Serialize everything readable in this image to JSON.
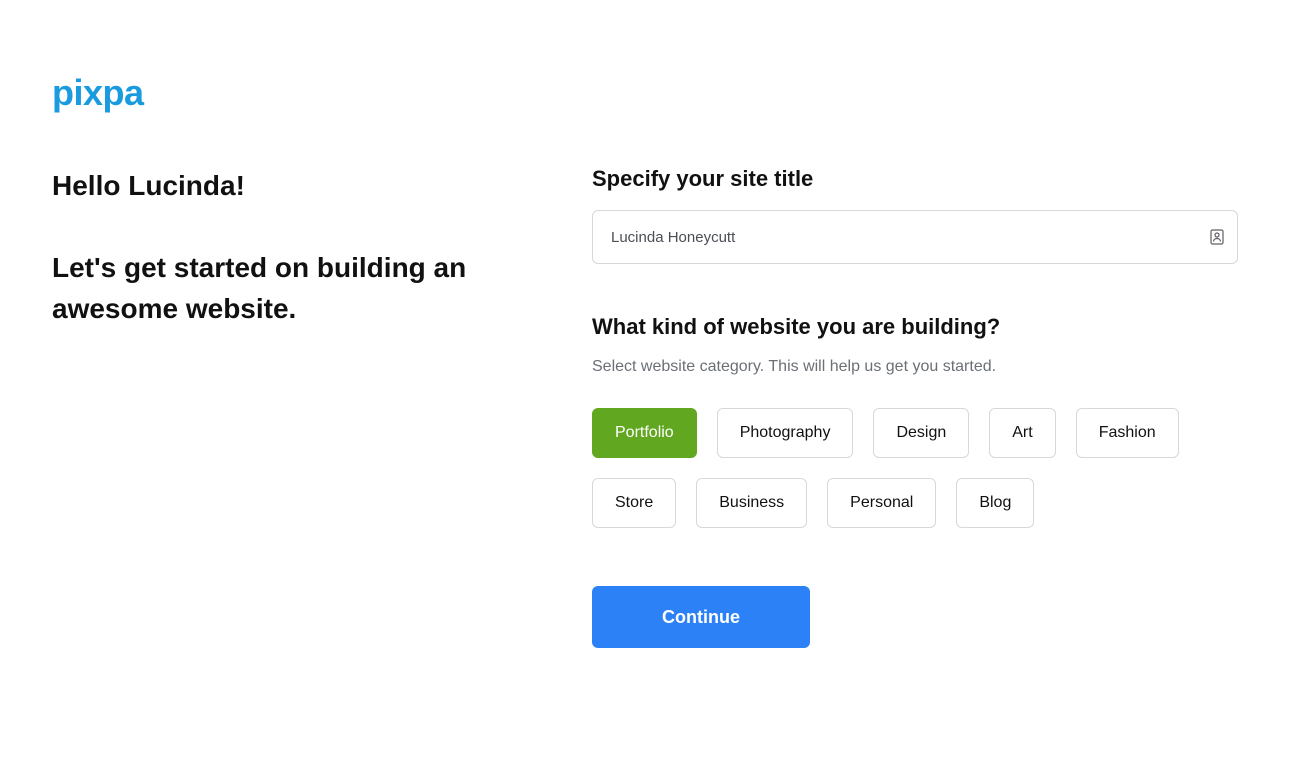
{
  "brand": {
    "logo_text": "pixpa"
  },
  "left": {
    "greeting": "Hello Lucinda!",
    "intro": "Let's get started on building an awesome website."
  },
  "form": {
    "site_title": {
      "label": "Specify your site title",
      "value": "Lucinda Honeycutt"
    },
    "category": {
      "label": "What kind of website you are building?",
      "subtext": "Select website category. This will help us get you started.",
      "options": [
        "Portfolio",
        "Photography",
        "Design",
        "Art",
        "Fashion",
        "Store",
        "Business",
        "Personal",
        "Blog"
      ],
      "selected_index": 0
    },
    "continue_label": "Continue"
  }
}
